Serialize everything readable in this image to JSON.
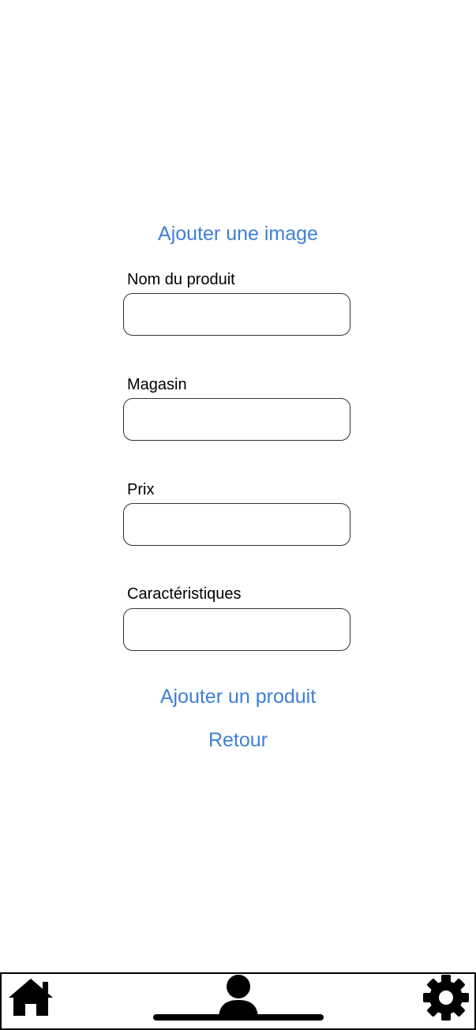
{
  "form": {
    "add_image_label": "Ajouter une image",
    "fields": [
      {
        "label": "Nom du produit",
        "value": ""
      },
      {
        "label": "Magasin",
        "value": ""
      },
      {
        "label": "Prix",
        "value": ""
      },
      {
        "label": "Caractéristiques",
        "value": ""
      }
    ],
    "submit_label": "Ajouter un produit",
    "back_label": "Retour"
  },
  "tabbar": {
    "items": [
      {
        "icon": "home-icon"
      },
      {
        "icon": "person-icon"
      },
      {
        "icon": "gear-icon"
      }
    ]
  },
  "colors": {
    "accent": "#3f7fd6",
    "text": "#000000",
    "border": "#333333"
  }
}
